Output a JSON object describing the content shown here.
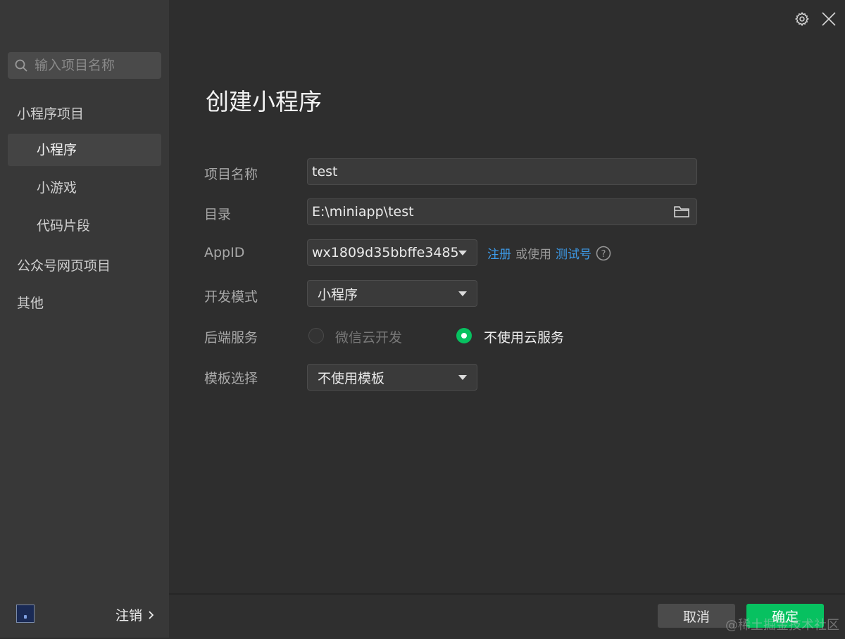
{
  "sidebar": {
    "search_placeholder": "输入项目名称",
    "group_miniprogram": "小程序项目",
    "items": [
      {
        "label": "小程序",
        "active": true
      },
      {
        "label": "小游戏",
        "active": false
      },
      {
        "label": "代码片段",
        "active": false
      }
    ],
    "group_official": "公众号网页项目",
    "group_other": "其他",
    "logout_label": "注销"
  },
  "header": {
    "icons": [
      "gear-icon",
      "close-icon"
    ]
  },
  "main": {
    "title": "创建小程序",
    "form": {
      "project_name_label": "项目名称",
      "project_name_value": "test",
      "directory_label": "目录",
      "directory_value": "E:\\miniapp\\test",
      "appid_label": "AppID",
      "appid_value": "wx1809d35bbffe3485",
      "appid_register_link": "注册",
      "appid_or_use": "或使用",
      "appid_test_link": "测试号",
      "dev_mode_label": "开发模式",
      "dev_mode_value": "小程序",
      "backend_label": "后端服务",
      "backend_options": [
        {
          "label": "微信云开发",
          "selected": false
        },
        {
          "label": "不使用云服务",
          "selected": true
        }
      ],
      "template_label": "模板选择",
      "template_value": "不使用模板"
    }
  },
  "footer": {
    "cancel_label": "取消",
    "confirm_label": "确定"
  },
  "watermark": "@稀土掘金技术社区",
  "colors": {
    "accent_green": "#07c160",
    "link_blue": "#3d9be9",
    "background": "#2e2e2e",
    "sidebar_bg": "#383838"
  }
}
